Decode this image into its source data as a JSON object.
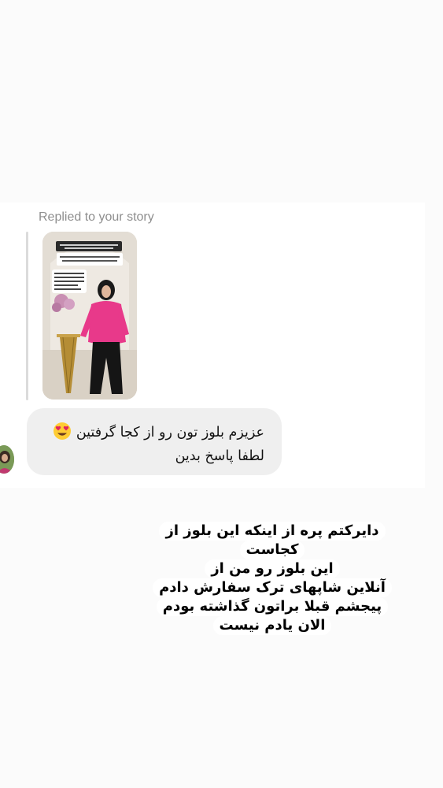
{
  "story_reply": {
    "label": "Replied to your story"
  },
  "message": {
    "line1": "عزیزم بلوز تون رو از کجا گرفتین",
    "emoji": "heart-eyes-emoji",
    "line2": "لطفا پاسخ بدین"
  },
  "caption": {
    "lines": [
      "دایرکتم پره از اینکه این بلوز از",
      "کجاست",
      "این بلوز رو من از",
      "آنلاین شاپهای ترک سفارش دادم",
      "پیجشم قبلا براتون گذاشته بودم",
      "الان یادم نیست"
    ]
  },
  "colors": {
    "bubble": "#efefef",
    "label": "#8e8e8e",
    "blouse": "#e8398a"
  }
}
